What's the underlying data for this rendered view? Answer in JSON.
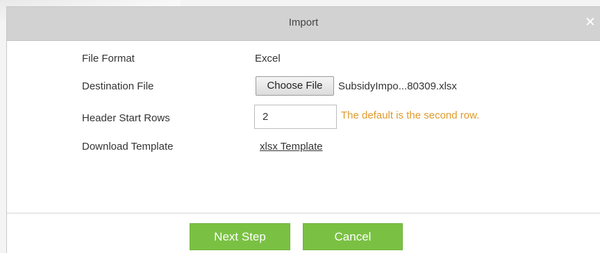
{
  "dialog": {
    "title": "Import",
    "close_icon": "close-icon"
  },
  "form": {
    "file_format": {
      "label": "File Format",
      "value": "Excel"
    },
    "destination_file": {
      "label": "Destination File",
      "button_label": "Choose File",
      "file_name": "SubsidyImpo...80309.xlsx"
    },
    "header_start_rows": {
      "label": "Header Start Rows",
      "value": "2",
      "hint": "The default is the second row."
    },
    "download_template": {
      "label": "Download Template",
      "link_text": "xlsx Template"
    }
  },
  "footer": {
    "next_label": "Next Step",
    "cancel_label": "Cancel"
  },
  "colors": {
    "primary_button": "#7ac143",
    "hint_text": "#e09a2a",
    "titlebar": "#d2d2d2"
  }
}
